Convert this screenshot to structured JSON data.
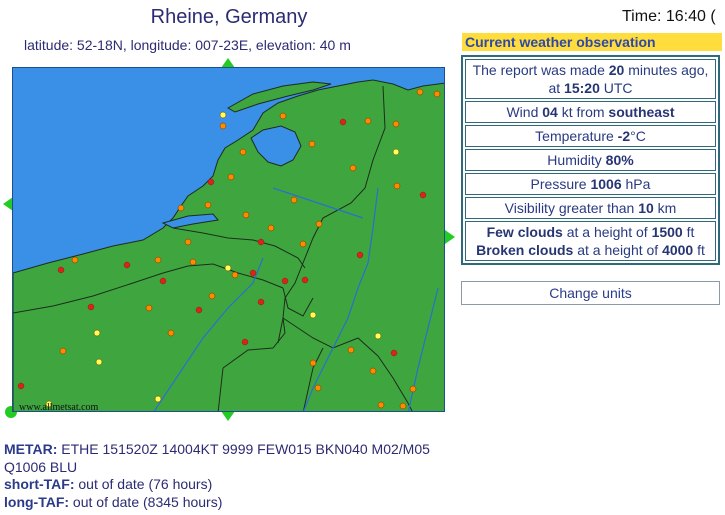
{
  "location": {
    "title": "Rheine, Germany",
    "coords": "latitude: 52-18N, longitude: 007-23E, elevation: 40 m"
  },
  "time": {
    "label": "Time: 16:40 ("
  },
  "map": {
    "credit": "www.allmetsat.com",
    "colors": {
      "sea": "#3a8fe6",
      "land": "#3fa63f",
      "border": "#1d2d1d",
      "river": "#2a6fd0"
    }
  },
  "observation": {
    "header": "Current weather observation",
    "report": {
      "pre": "The report was made ",
      "minutes": "20",
      "mid": " minutes ago, at ",
      "time": "15:20",
      "post": " UTC"
    },
    "wind": {
      "pre": "Wind ",
      "speed": "04",
      "mid": " kt from ",
      "dir": "southeast"
    },
    "temperature": {
      "pre": "Temperature ",
      "value": "-2",
      "unit": "°C"
    },
    "humidity": {
      "pre": "Humidity ",
      "value": "80%"
    },
    "pressure": {
      "pre": "Pressure ",
      "value": "1006",
      "unit": " hPa"
    },
    "visibility": {
      "pre": "Visibility greater than ",
      "value": "10",
      "unit": " km"
    },
    "clouds": [
      {
        "cover": "Few clouds",
        "mid": " at a height of ",
        "height": "1500",
        "unit": " ft"
      },
      {
        "cover": "Broken clouds",
        "mid": " at a height of ",
        "height": "4000",
        "unit": " ft"
      }
    ]
  },
  "change_units": "Change units",
  "bottom": {
    "metar_label": "METAR:",
    "metar_text": " ETHE 151520Z 14004KT 9999 FEW015 BKN040 M02/M05 Q1006 BLU",
    "short_taf_label": "short-TAF:",
    "short_taf_text": " out of date (76 hours)",
    "long_taf_label": "long-TAF:",
    "long_taf_text": " out of date (8345 hours)"
  }
}
